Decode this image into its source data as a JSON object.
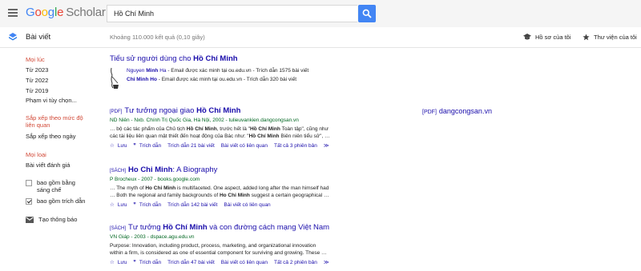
{
  "header": {
    "logo_google": [
      "G",
      "o",
      "o",
      "g",
      "l",
      "e"
    ],
    "logo_scholar": "Scholar",
    "search_value": "Hồ Chí Minh"
  },
  "subheader": {
    "articles_label": "Bài viết",
    "results_count": "Khoảng 110.000 kết quả (0,10 giây)",
    "my_profile": "Hồ sơ của tôi",
    "my_library": "Thư viện của tôi"
  },
  "sidebar": {
    "time_any": "Mọi lúc",
    "since_2023": "Từ 2023",
    "since_2022": "Từ 2022",
    "since_2019": "Từ 2019",
    "custom_range": "Phạm vi tùy chọn...",
    "sort_relevance_1": "Sắp xếp theo mức độ",
    "sort_relevance_2": "liên quan",
    "sort_date": "Sắp xếp theo ngày",
    "type_any": "Mọi loại",
    "type_review": "Bài viết đánh giá",
    "include_patents_1": "bao gồm bằng",
    "include_patents_2": "sáng chế",
    "include_citations": "bao gồm trích dẫn",
    "create_alert": "Tạo thông báo"
  },
  "user_profiles": {
    "title_prefix": "Tiểu sử người dùng cho ",
    "title_bold": "Hồ Chí Minh",
    "line1_name_pre": "Nguyen ",
    "line1_name_bold": "Minh",
    "line1_name_post": " Ha",
    "line1_info": " - Email được xác minh tại ou.edu.vn - Trích dẫn 1575 bài viết",
    "line2_name_bold": "Chi Minh Ho",
    "line2_info": " - Email được xác minh tại ou.edu.vn - Trích dẫn 320 bài viết"
  },
  "results": [
    {
      "tag": "[PDF]",
      "title_pre": "Tư tưởng ngoại giao ",
      "title_bold": "Hồ Chí Minh",
      "title_post": "",
      "meta": "ND Niên - Nxb. Chính Trị Quốc Gia, Hà Nội, 2002 - tulieuvankien.dangcongsan.vn",
      "snippet_1a": "… bộ các tác phẩm của Chủ tịch ",
      "snippet_1b": "Hồ Chí Minh",
      "snippet_1c": ", trước hết là \"",
      "snippet_1d": "Hồ Chí Minh",
      "snippet_1e": " Toàn tập\", cũng như",
      "snippet_2a": "các tài liệu liên quan mật thiết đến hoạt động của Bác như: \"",
      "snippet_2b": "Hồ Chí Minh",
      "snippet_2c": " Biên niên tiểu sử\", …",
      "save": "Lưu",
      "cite": "Trích dẫn",
      "cited_by": "Trích dẫn 21 bài viết",
      "related": "Bài viết có liên quan",
      "versions": "Tất cả 3 phiên bản"
    },
    {
      "tag": "[SÁCH]",
      "title_pre": "",
      "title_bold": "Ho Chi Minh",
      "title_post": ": A Biography",
      "meta": "P Brocheux - 2007 - books.google.com",
      "snippet_1a": "… The myth of ",
      "snippet_1b": "Ho Chi Minh",
      "snippet_1c": " is multifaceted. One aspect, added long after the man himself had",
      "snippet_1d": "",
      "snippet_1e": "",
      "snippet_2a": "… Both the regional and family backgrounds of ",
      "snippet_2b": "Ho Chi Minh",
      "snippet_2c": " suggest a certain geographical …",
      "save": "Lưu",
      "cite": "Trích dẫn",
      "cited_by": "Trích dẫn 142 bài viết",
      "related": "Bài viết có liên quan",
      "versions": ""
    },
    {
      "tag": "[SÁCH]",
      "title_pre": "Tư tưởng ",
      "title_bold": "Hồ Chí Minh",
      "title_post": " và con đường cách mạng Việt Nam",
      "meta": "VN Giáp - 2003 - dspace.agu.edu.vn",
      "snippet_1a": "Purpose: Innovation, including product, process, marketing, and organizational innovation",
      "snippet_1b": "",
      "snippet_1c": "",
      "snippet_1d": "",
      "snippet_1e": "",
      "snippet_2a": "within a firm, is considered as one of essential component for surviving and growing. These …",
      "snippet_2b": "",
      "snippet_2c": "",
      "save": "Lưu",
      "cite": "Trích dẫn",
      "cited_by": "Trích dẫn 47 bài viết",
      "related": "Bài viết có liên quan",
      "versions": "Tất cả 2 phiên bản"
    }
  ],
  "side_link": {
    "tag": "[PDF]",
    "domain": "dangcongsan.vn"
  },
  "colors": {
    "link": "#1a0dab",
    "green": "#006621",
    "active": "#d14836",
    "accent": "#4285f4"
  }
}
